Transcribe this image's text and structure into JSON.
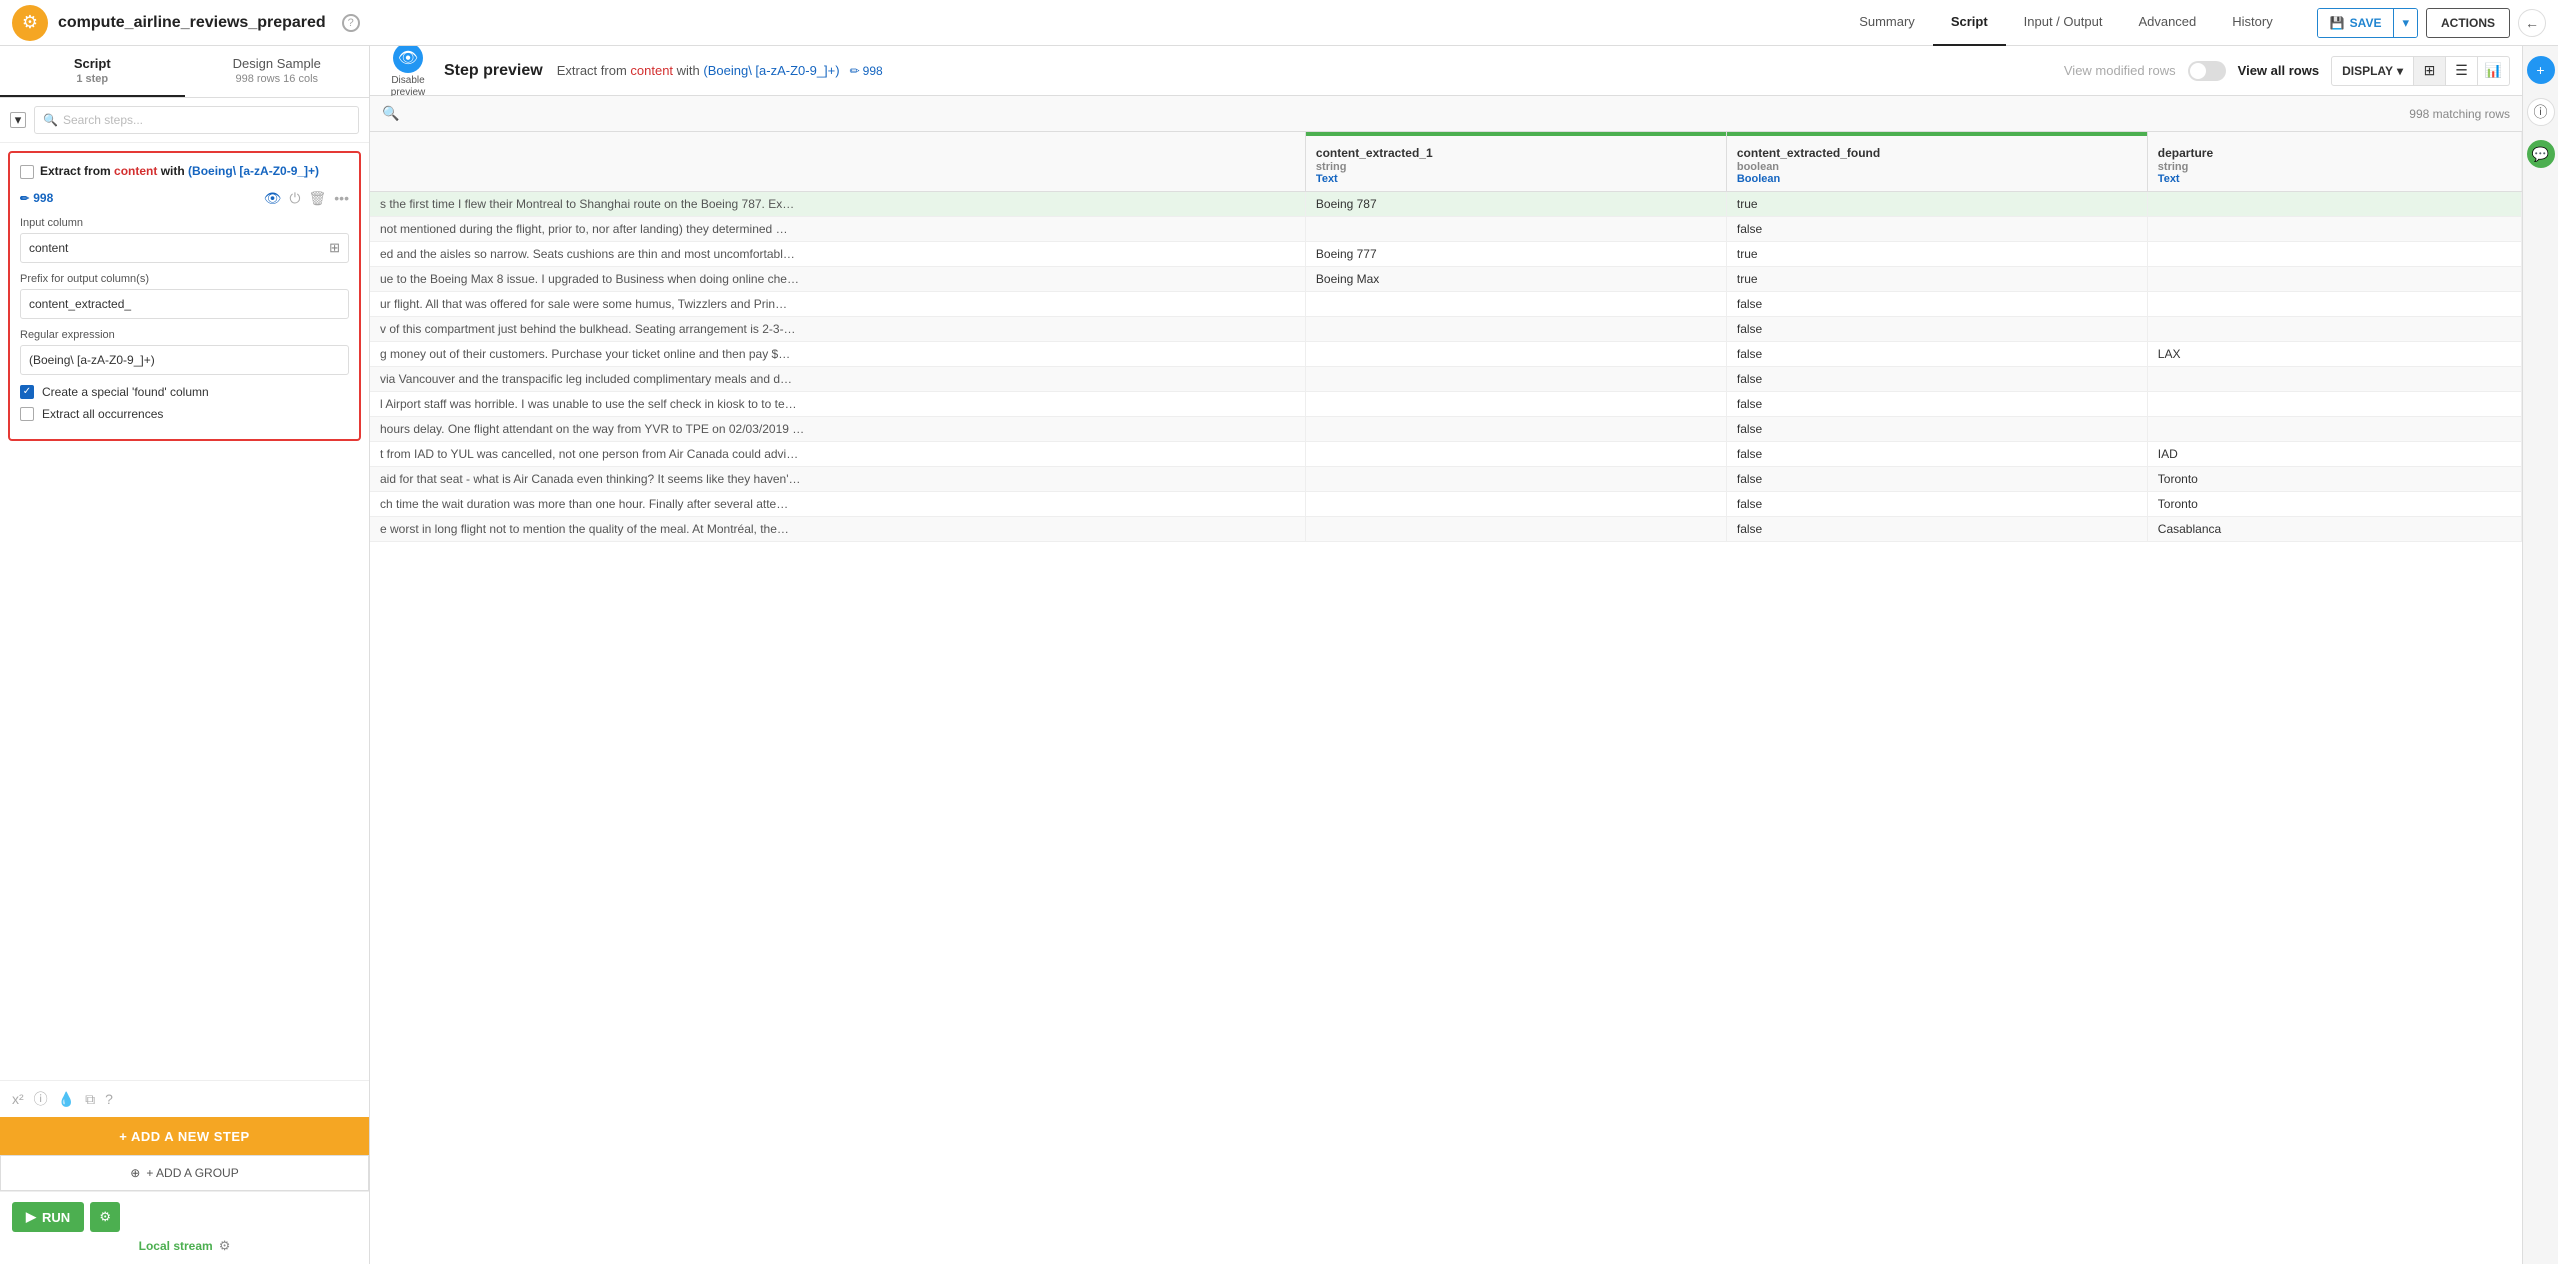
{
  "topbar": {
    "logo": "⚙",
    "workflow_title": "compute_airline_reviews_prepared",
    "status_icon": "?",
    "nav_items": [
      "Summary",
      "Script",
      "Input / Output",
      "Advanced",
      "History"
    ],
    "active_nav": "Script",
    "save_label": "SAVE",
    "actions_label": "ACTIONS",
    "back_icon": "←"
  },
  "left_panel": {
    "tabs": [
      {
        "label": "Script",
        "sub": "1 step",
        "active": true
      },
      {
        "label": "Design Sample",
        "sub": "998 rows 16 cols",
        "active": false
      }
    ],
    "search_placeholder": "Search steps...",
    "step_card": {
      "title_parts": [
        "Extract",
        " from ",
        "content",
        " with ",
        "(Boeing\\ [a-zA-Z0-9_]+)"
      ],
      "edit_num": "998",
      "checkbox_checked": false,
      "input_column_label": "Input column",
      "input_column_value": "content",
      "prefix_label": "Prefix for output column(s)",
      "prefix_value": "content_extracted_",
      "regex_label": "Regular expression",
      "regex_value": "(Boeing\\ [a-zA-Z0-9_]+)",
      "found_column_label": "Create a special 'found' column",
      "found_column_checked": true,
      "extract_all_label": "Extract all occurrences",
      "extract_all_checked": false
    },
    "add_step_label": "+ ADD A NEW STEP",
    "add_group_label": "+ ADD A GROUP",
    "run_label": "RUN",
    "local_stream_label": "Local stream"
  },
  "step_preview": {
    "disable_label": "Disable preview",
    "title": "Step preview",
    "desc_parts": [
      "Extract from ",
      "content",
      " with ",
      "(Boeing\\ [a-zA-Z0-9_]+)"
    ],
    "edit_num": "998",
    "view_modified_label": "View modified rows",
    "view_all_label": "View all rows",
    "display_label": "DISPLAY",
    "matching_rows": "998 matching rows"
  },
  "table": {
    "columns": [
      {
        "name": "content_extracted_1",
        "type": "string",
        "type_link": "Text"
      },
      {
        "name": "content_extracted_found",
        "type": "boolean",
        "type_link": "Boolean"
      },
      {
        "name": "departure",
        "type": "string",
        "type_link": "Text"
      }
    ],
    "rows": [
      {
        "content": "s the first time I flew their Montreal to Shanghai route on the Boeing 787. Ex…",
        "extracted_1": "Boeing 787",
        "found": "true",
        "departure": ""
      },
      {
        "content": "not mentioned during the flight, prior to, nor after landing) they determined …",
        "extracted_1": "",
        "found": "false",
        "departure": ""
      },
      {
        "content": "ed and the aisles so narrow. Seats cushions are thin and most uncomfortabl…",
        "extracted_1": "Boeing 777",
        "found": "true",
        "departure": ""
      },
      {
        "content": "ue to the Boeing Max 8 issue. I upgraded to Business when doing online che…",
        "extracted_1": "Boeing Max",
        "found": "true",
        "departure": ""
      },
      {
        "content": "ur flight. All that was offered for sale were some humus, Twizzlers and Prin…",
        "extracted_1": "",
        "found": "false",
        "departure": ""
      },
      {
        "content": "v of this compartment just behind the bulkhead. Seating arrangement is 2-3-…",
        "extracted_1": "",
        "found": "false",
        "departure": ""
      },
      {
        "content": "g money out of their customers. Purchase your ticket online and then pay $…",
        "extracted_1": "",
        "found": "false",
        "departure": "LAX"
      },
      {
        "content": "via Vancouver and the transpacific leg included complimentary meals and d…",
        "extracted_1": "",
        "found": "false",
        "departure": ""
      },
      {
        "content": "l Airport staff was horrible. I was unable to use the self check in kiosk to to te…",
        "extracted_1": "",
        "found": "false",
        "departure": ""
      },
      {
        "content": "hours delay. One flight attendant on the way from YVR to TPE on 02/03/2019 …",
        "extracted_1": "",
        "found": "false",
        "departure": ""
      },
      {
        "content": "t from IAD to YUL was cancelled, not one person from Air Canada could advi…",
        "extracted_1": "",
        "found": "false",
        "departure": "IAD"
      },
      {
        "content": "aid for that seat - what is Air Canada even thinking? It seems like they haven'…",
        "extracted_1": "",
        "found": "false",
        "departure": "Toronto"
      },
      {
        "content": "ch time the wait duration was more than one hour. Finally after several atte…",
        "extracted_1": "",
        "found": "false",
        "departure": "Toronto"
      },
      {
        "content": "e worst in long flight not to mention the quality of the meal. At Montréal, the…",
        "extracted_1": "",
        "found": "false",
        "departure": "Casablanca"
      }
    ]
  }
}
